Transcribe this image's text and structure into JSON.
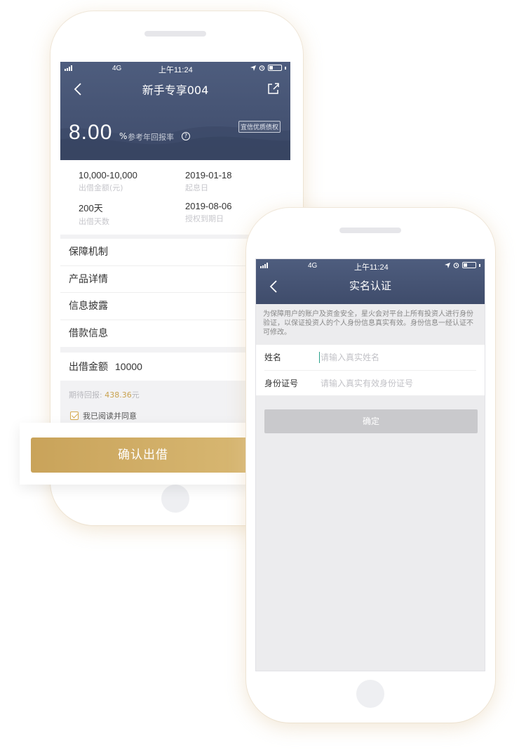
{
  "phone_left": {
    "status": {
      "network": "4G",
      "time": "上午11:24"
    },
    "nav": {
      "title": "新手专享004"
    },
    "hero": {
      "rate": "8.00",
      "rate_unit": "%",
      "rate_label": "参考年回报率",
      "badge": "宜信优质债权"
    },
    "stats": [
      {
        "value": "10,000-10,000",
        "label": "出借金额(元)"
      },
      {
        "value": "2019-01-18",
        "label": "起息日"
      },
      {
        "value": "200天",
        "label": "出借天数"
      },
      {
        "value": "2019-08-06",
        "label": "授权到期日"
      }
    ],
    "menu": [
      "保障机制",
      "产品详情",
      "信息披露",
      "借款信息"
    ],
    "amount": {
      "label": "出借金额",
      "value": "10000"
    },
    "expect": {
      "label": "期待回报:",
      "value": "438.36",
      "unit": "元"
    },
    "agree": {
      "text": "我已阅读并同意",
      "checked": true
    },
    "confirm": {
      "label": "确认出借"
    }
  },
  "phone_right": {
    "status": {
      "network": "4G",
      "time": "上午11:24"
    },
    "nav": {
      "title": "实名认证"
    },
    "notice": "为保障用户的账户及资金安全，星火会对平台上所有投资人进行身份验证，以保证投资人的个人身份信息真实有效。身份信息一经认证不可修改。",
    "form": {
      "name": {
        "label": "姓名",
        "placeholder": "请输入真实姓名"
      },
      "id": {
        "label": "身份证号",
        "placeholder": "请输入真实有效身份证号"
      }
    },
    "submit": {
      "label": "确定"
    }
  },
  "colors": {
    "header": "#4a587a",
    "gold": "#c9a24f",
    "disabled": "#c9c9cc"
  },
  "icons": [
    "back-icon",
    "share-icon",
    "help-icon",
    "checkbox-checked-icon",
    "battery-icon",
    "signal-icon",
    "location-icon",
    "alarm-icon"
  ]
}
